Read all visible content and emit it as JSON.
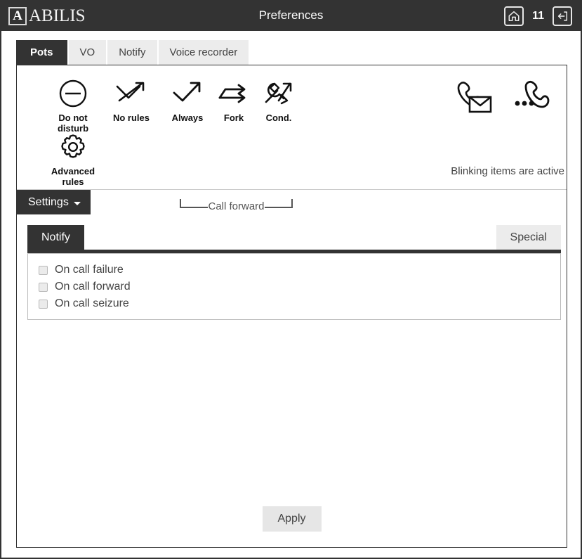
{
  "header": {
    "logo_badge": "A",
    "logo_word": "ABILIS",
    "title": "Preferences",
    "home_icon": "home-icon",
    "count": "11",
    "logout_icon": "logout-icon"
  },
  "tabs": [
    {
      "label": "Pots",
      "active": true
    },
    {
      "label": "VO",
      "active": false
    },
    {
      "label": "Notify",
      "active": false
    },
    {
      "label": "Voice recorder",
      "active": false
    }
  ],
  "icon_bar": {
    "items": [
      {
        "name": "do-not-disturb",
        "label": "Do not\ndisturb",
        "label_line1": "Do not",
        "label_line2": "disturb",
        "icon": "minus-circle-icon"
      },
      {
        "name": "no-rules",
        "label": "No rules",
        "icon": "crossed-arrow-icon"
      },
      {
        "name": "always",
        "label": "Always",
        "icon": "arrow-up-right-icon"
      },
      {
        "name": "fork",
        "label": "Fork",
        "icon": "fork-arrows-icon"
      },
      {
        "name": "cond",
        "label": "Cond.",
        "icon": "wrench-arrow-icon"
      },
      {
        "name": "advanced-rules",
        "label": "Advanced\nrules",
        "label_line1": "Advanced",
        "label_line2": "rules",
        "icon": "gear-icon"
      }
    ],
    "group_label": "Call forward",
    "right_icons": [
      {
        "name": "voicemail",
        "icon": "phone-envelope-icon"
      },
      {
        "name": "recent-calls",
        "icon": "phone-dots-icon"
      }
    ],
    "note": "Blinking items are active"
  },
  "settings": {
    "label": "Settings",
    "caret": "chevron-down-icon"
  },
  "subtabs": [
    {
      "label": "Notify",
      "active": true
    },
    {
      "label": "Special",
      "active": false
    }
  ],
  "notify_options": [
    {
      "label": "On call failure",
      "checked": false
    },
    {
      "label": "On call forward",
      "checked": false
    },
    {
      "label": "On call seizure",
      "checked": false
    }
  ],
  "footer": {
    "apply_label": "Apply"
  },
  "colors": {
    "dark": "#333333",
    "light_tab": "#ececec",
    "button": "#e6e6e6",
    "text": "#444444"
  }
}
